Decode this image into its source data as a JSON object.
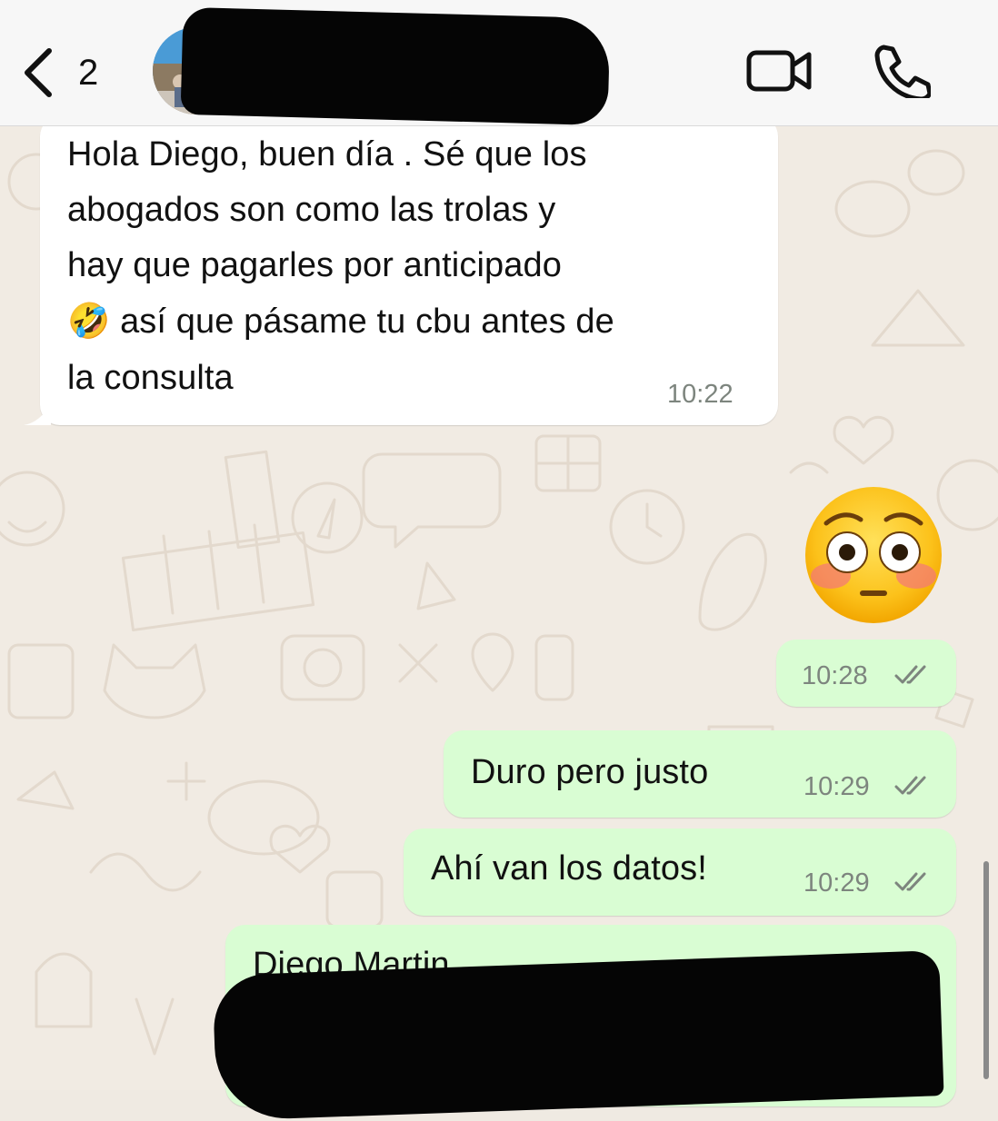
{
  "header": {
    "back_count": "2",
    "contact_name": ""
  },
  "messages": [
    {
      "direction": "incoming",
      "lines": [
        "Hola Diego, buen día . Sé que los",
        "abogados son como las trolas y",
        "hay que pagarles por anticipado",
        "🤣 así que pásame tu cbu antes de",
        "la consulta"
      ],
      "time": "10:22"
    },
    {
      "direction": "outgoing",
      "emoji": "flushed-face-emoji",
      "time": "10:28",
      "status": "read"
    },
    {
      "direction": "outgoing",
      "text": "Duro pero justo",
      "time": "10:29",
      "status": "read"
    },
    {
      "direction": "outgoing",
      "text": "Ahí van los datos!",
      "time": "10:29",
      "status": "read"
    },
    {
      "direction": "outgoing",
      "text": "Diego Martin",
      "redacted": true
    }
  ],
  "colors": {
    "incoming_bubble": "#ffffff",
    "outgoing_bubble": "#d9fdd3",
    "chat_background": "#f1ebe3",
    "header_background": "#f7f7f7",
    "timestamp": "#7d857e"
  }
}
